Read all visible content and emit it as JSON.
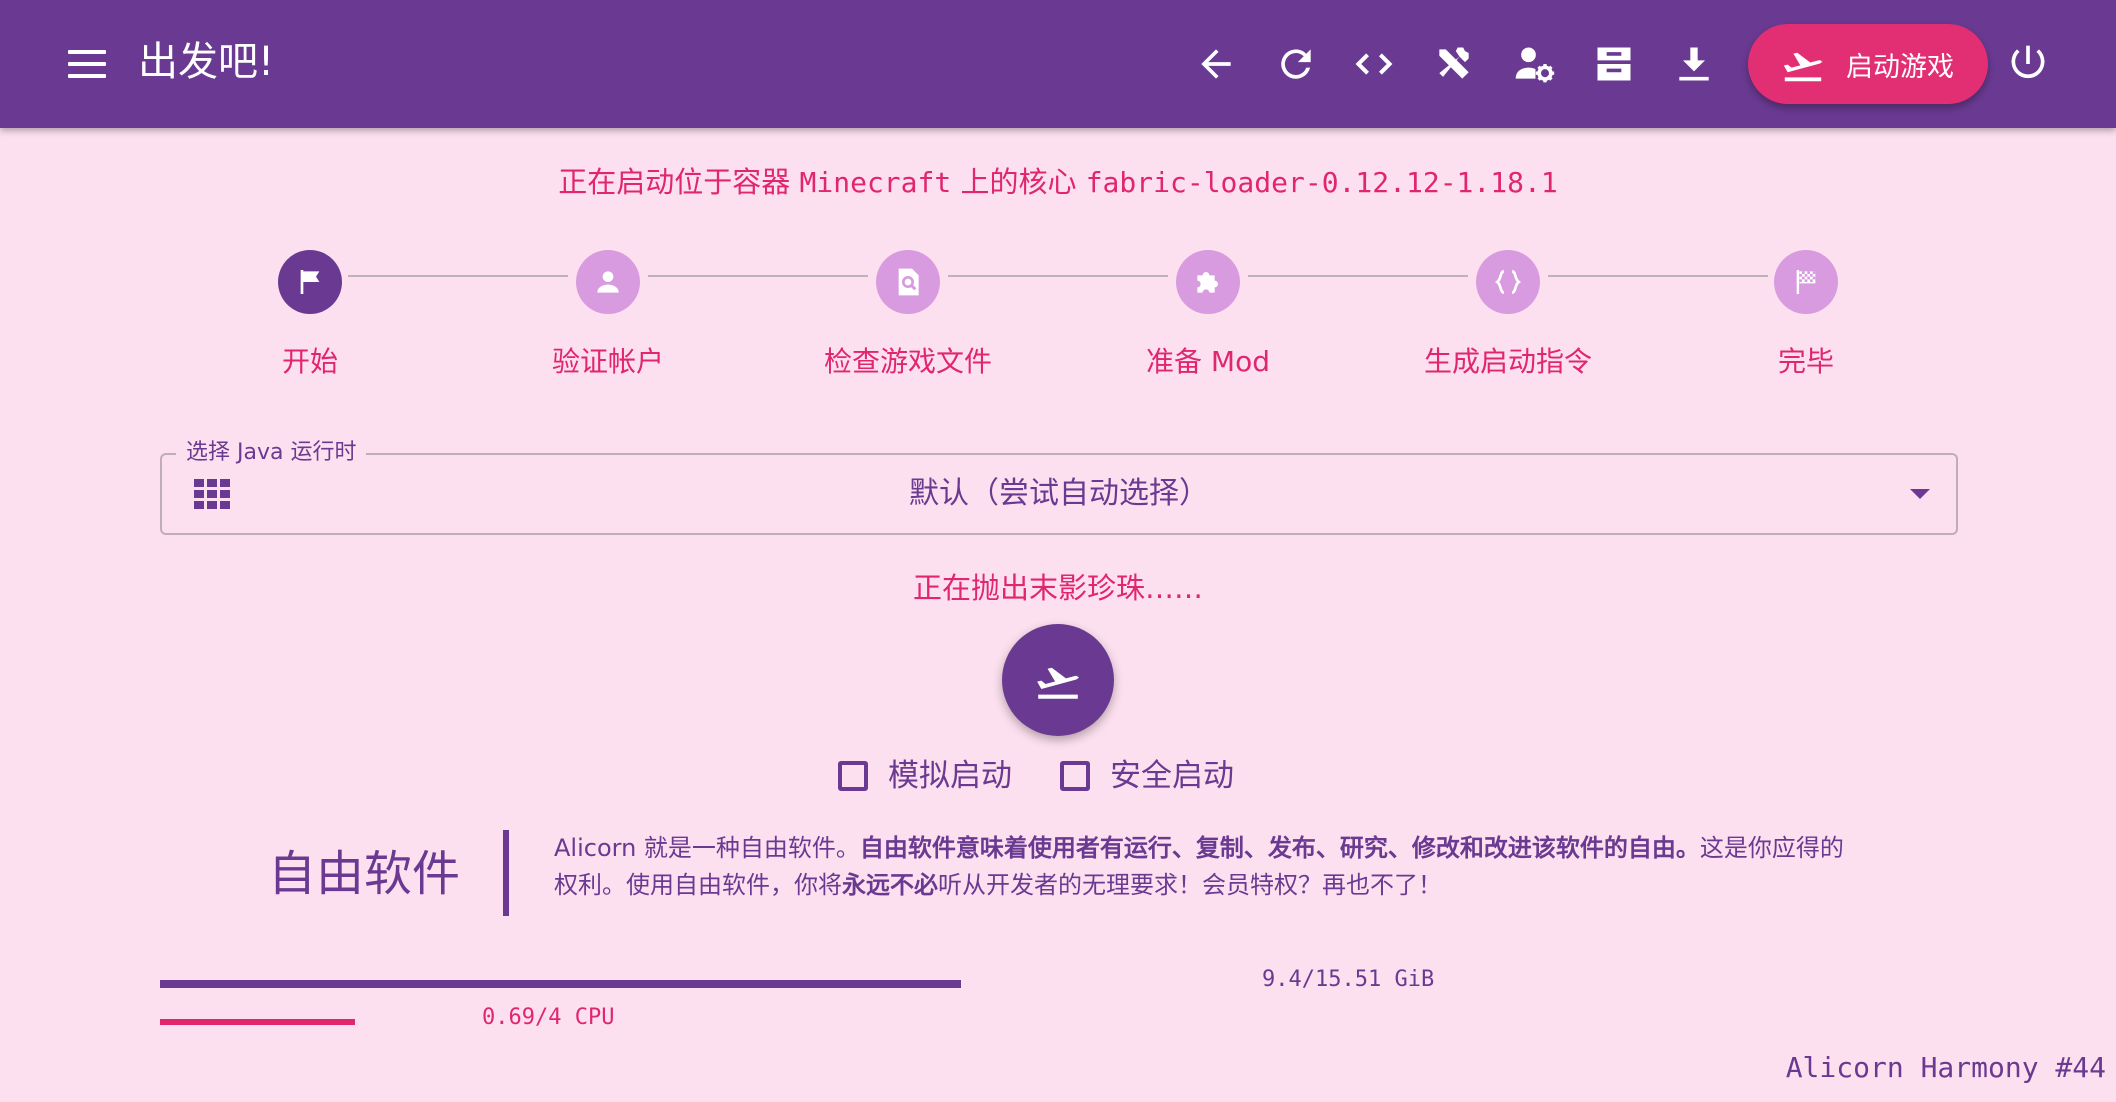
{
  "appbar": {
    "title": "出发吧!",
    "launch_label": "启动游戏",
    "tools": [
      "back-arrow-icon",
      "refresh-icon",
      "code-icon",
      "tools-icon",
      "user-settings-icon",
      "archive-icon",
      "download-icon"
    ],
    "power": "power-icon"
  },
  "main": {
    "status_prefix": "正在启动位于容器",
    "container": "Minecraft",
    "status_middle": "上的核心",
    "core": "fabric-loader-0.12.12-1.18.1",
    "steps": [
      {
        "label": "开始",
        "icon": "flag-icon"
      },
      {
        "label": "验证帐户",
        "icon": "account-icon"
      },
      {
        "label": "检查游戏文件",
        "icon": "file-search-icon"
      },
      {
        "label": "准备 Mod",
        "icon": "puzzle-icon"
      },
      {
        "label": "生成启动指令",
        "icon": "braces-icon"
      },
      {
        "label": "完毕",
        "icon": "finish-flag-icon"
      }
    ],
    "active_step": 0,
    "java": {
      "legend": "选择 Java 运行时",
      "value": "默认（尝试自动选择）"
    },
    "progress_text": "正在抛出末影珍珠……",
    "checkboxes": [
      {
        "label": "模拟启动",
        "checked": false
      },
      {
        "label": "安全启动",
        "checked": false
      }
    ],
    "free_software": {
      "title": "自由软件",
      "text_1": "Alicorn 就是一种自由软件。",
      "text_2": "自由软件意味着使用者有运行、复制、发布、研究、修改和改进该软件的自由。",
      "text_3": "这是你应得的权利。使用自由软件，你将",
      "text_4": "永远不必",
      "text_5": "听从开发者的无理要求！会员特权？再也不了！"
    },
    "memory": {
      "label": "9.4/15.51 GiB",
      "used": 9.4,
      "total": 15.51
    },
    "cpu": {
      "label": "0.69/4 CPU",
      "used": 0.69,
      "total": 4
    },
    "version": "Alicorn Harmony #44"
  },
  "colors": {
    "primary": "#6a3a92",
    "accent": "#e22f73",
    "background": "#fde0ef",
    "step_inactive": "#d99be0"
  }
}
